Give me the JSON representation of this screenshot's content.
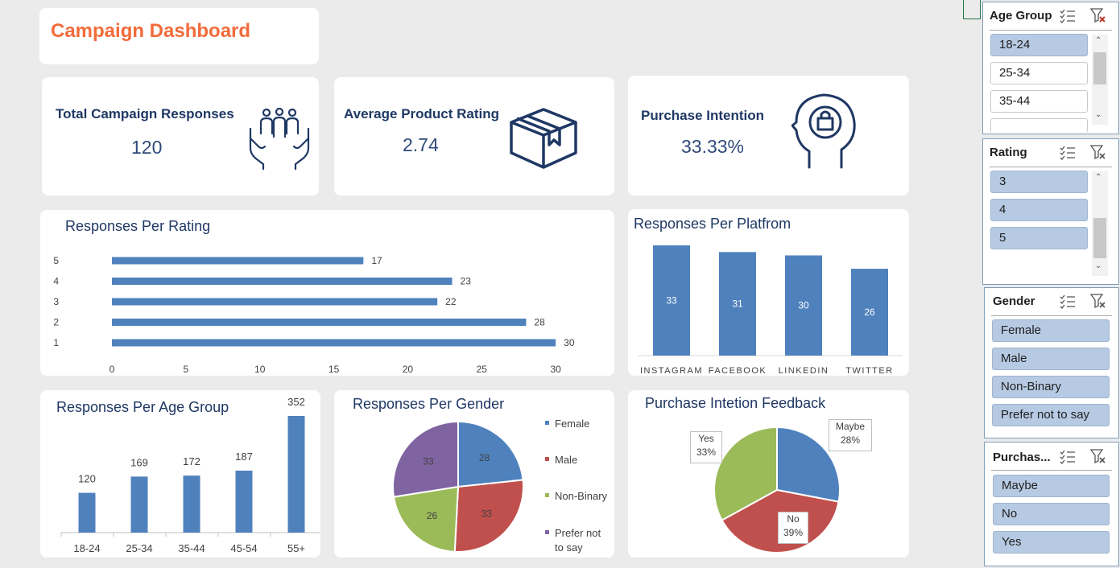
{
  "dashboard": {
    "title": "Campaign Dashboard"
  },
  "kpis": [
    {
      "title": "Total  Campaign Responses",
      "value": "120",
      "icon": "people-in-hands-icon"
    },
    {
      "title": "Average Product Rating",
      "value": "2.74",
      "icon": "box-icon"
    },
    {
      "title": "Purchase Intention",
      "value": "33.33%",
      "icon": "head-shopping-bag-icon"
    }
  ],
  "colors": {
    "blue": "#4f81bd",
    "red": "#c0504d",
    "green": "#9bbb59",
    "purple": "#8064a2",
    "accent": "#f26b3a",
    "navy": "#1f3864"
  },
  "chart_data": [
    {
      "type": "bar",
      "title": "Responses Per Rating",
      "orientation": "horizontal",
      "categories": [
        "1",
        "2",
        "3",
        "4",
        "5"
      ],
      "values": [
        30,
        28,
        22,
        23,
        17
      ],
      "xlim": [
        0,
        35
      ],
      "xticks": [
        "0",
        "5",
        "10",
        "15",
        "20",
        "25",
        "30",
        "35"
      ]
    },
    {
      "type": "bar",
      "title": "Responses Per Platfrom",
      "categories": [
        "INSTAGRAM",
        "FACEBOOK",
        "LINKEDIN",
        "TWITTER"
      ],
      "values": [
        33,
        31,
        30,
        26
      ]
    },
    {
      "type": "bar",
      "title": "Responses Per Age Group",
      "categories": [
        "18-24",
        "25-34",
        "35-44",
        "45-54",
        "55+"
      ],
      "values": [
        120,
        169,
        172,
        187,
        352
      ]
    },
    {
      "type": "pie",
      "title": "Responses Per Gender",
      "categories": [
        "Female",
        "Male",
        "Non-Binary",
        "Prefer not to say"
      ],
      "values": [
        28,
        33,
        26,
        33
      ],
      "legend": "right"
    },
    {
      "type": "pie",
      "title": "Purchase Intetion Feedback",
      "categories": [
        "Maybe",
        "No",
        "Yes"
      ],
      "values": [
        28,
        39,
        33
      ],
      "labels": [
        "28%",
        "39%",
        "33%"
      ]
    }
  ],
  "slicers": {
    "age_group": {
      "title": "Age Group",
      "items": [
        "18-24",
        "25-34",
        "35-44"
      ]
    },
    "rating": {
      "title": "Rating",
      "items": [
        "3",
        "4",
        "5"
      ]
    },
    "gender": {
      "title": "Gender",
      "items": [
        "Female",
        "Male",
        "Non-Binary",
        "Prefer not to say"
      ]
    },
    "purchase": {
      "title": "Purchas...",
      "items": [
        "Maybe",
        "No",
        "Yes"
      ]
    }
  }
}
